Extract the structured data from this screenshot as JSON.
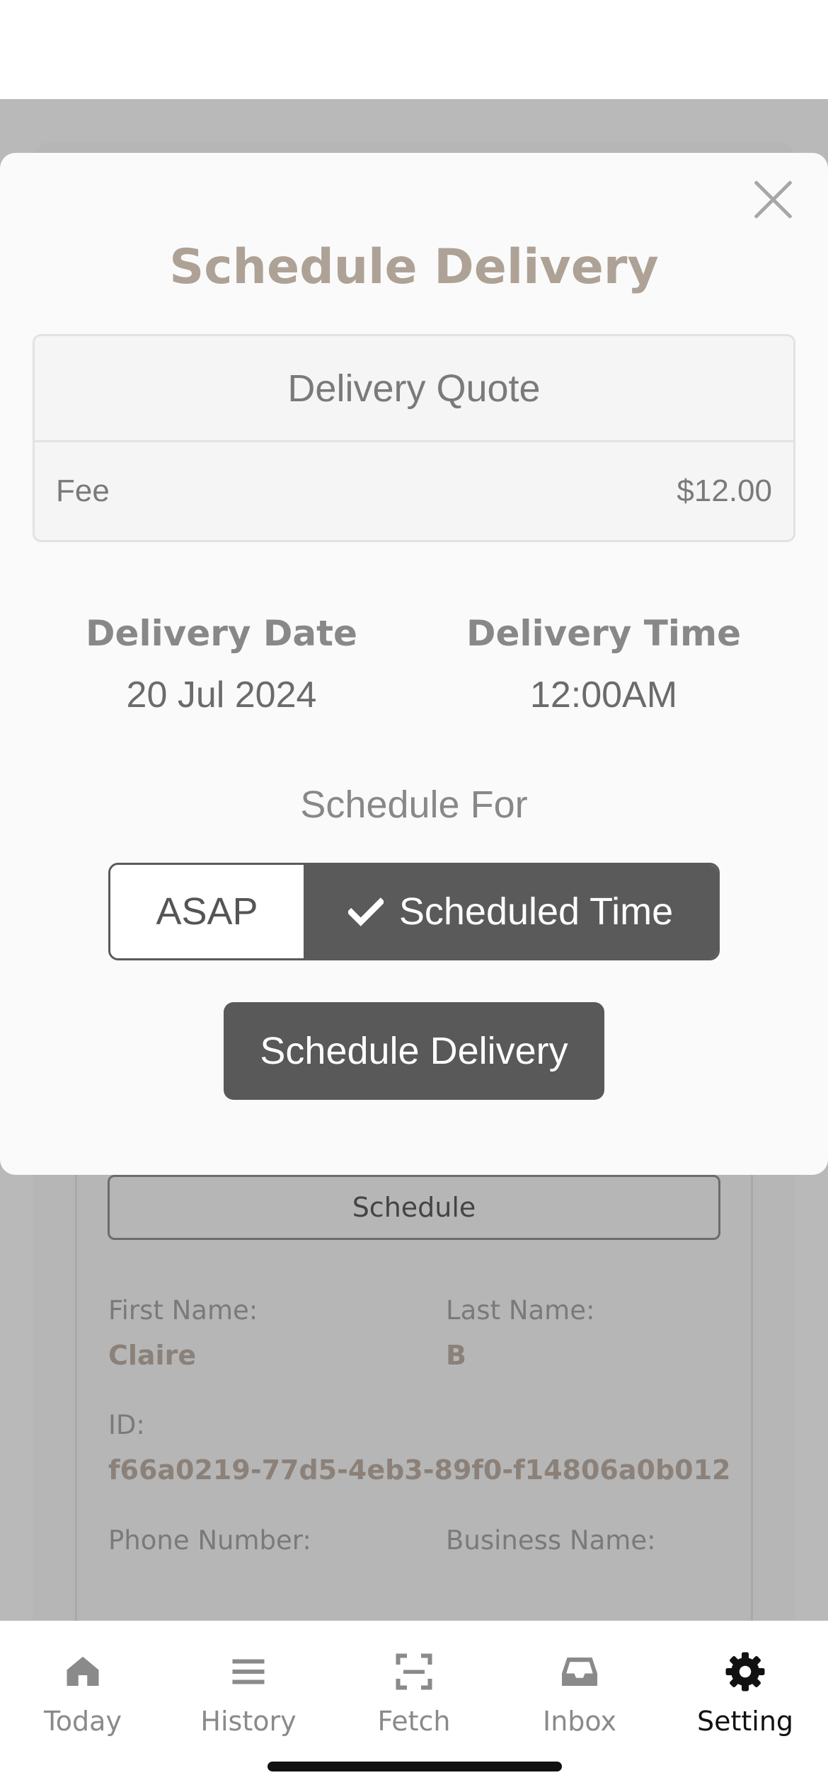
{
  "modal": {
    "title": "Schedule Delivery",
    "quote": {
      "heading": "Delivery Quote",
      "fee_label": "Fee",
      "fee_value": "$12.00"
    },
    "delivery_date_label": "Delivery Date",
    "delivery_date_value": "20 Jul 2024",
    "delivery_time_label": "Delivery Time",
    "delivery_time_value": "12:00AM",
    "schedule_for_label": "Schedule For",
    "options": {
      "asap": "ASAP",
      "scheduled": "Scheduled Time",
      "selected": "scheduled"
    },
    "submit_label": "Schedule Delivery"
  },
  "background": {
    "schedule_button": "Schedule",
    "first_name_label": "First Name:",
    "first_name_value": "Claire",
    "last_name_label": "Last Name:",
    "last_name_value": "B",
    "id_label": "ID:",
    "id_value": "f66a0219-77d5-4eb3-89f0-f14806a0b012",
    "phone_label": "Phone Number:",
    "business_label": "Business Name:"
  },
  "tabbar": {
    "items": [
      {
        "label": "Today",
        "icon": "home-icon"
      },
      {
        "label": "History",
        "icon": "list-icon"
      },
      {
        "label": "Fetch",
        "icon": "scan-icon"
      },
      {
        "label": "Inbox",
        "icon": "inbox-icon"
      },
      {
        "label": "Setting",
        "icon": "gear-icon"
      }
    ],
    "active": "Setting"
  },
  "colors": {
    "title": "#aea196",
    "primary": "#595959",
    "overlay": "#b9b9b9"
  }
}
